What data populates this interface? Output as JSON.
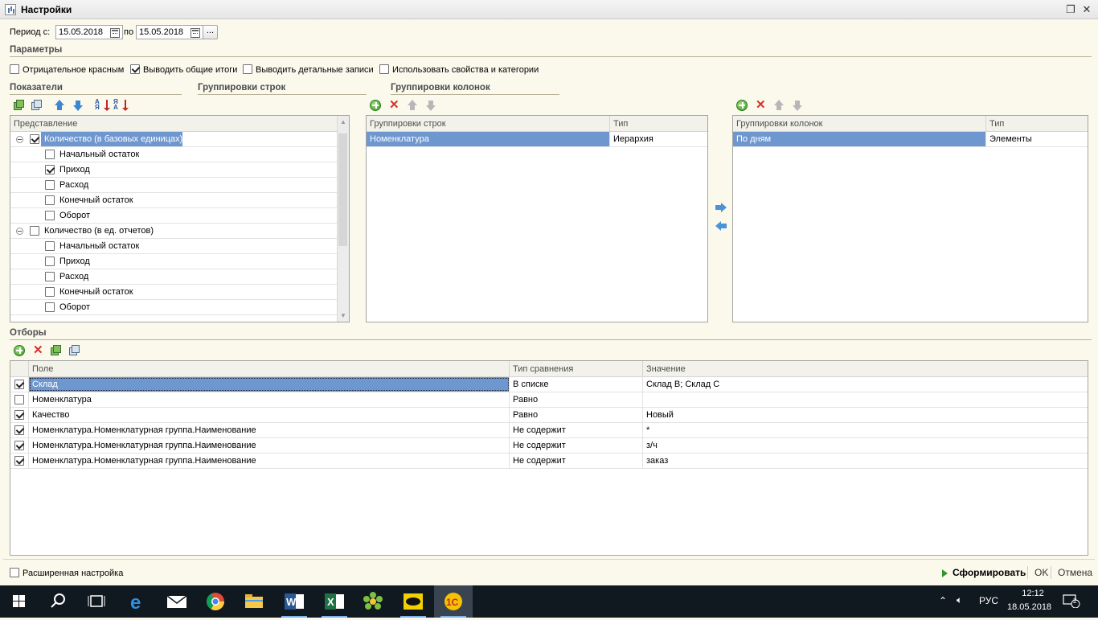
{
  "window": {
    "title": "Настройки"
  },
  "period": {
    "from_label": "Период с:",
    "from_value": "15.05.2018",
    "to_label": "по",
    "to_value": "15.05.2018",
    "more_label": "..."
  },
  "parameters": {
    "title": "Параметры",
    "options": [
      {
        "label": "Отрицательное красным",
        "checked": false
      },
      {
        "label": "Выводить общие итоги",
        "checked": true
      },
      {
        "label": "Выводить детальные записи",
        "checked": false
      },
      {
        "label": "Использовать свойства и категории",
        "checked": false
      }
    ]
  },
  "indicators": {
    "title": "Показатели",
    "header": "Представление",
    "groups": [
      {
        "label": "Количество (в базовых единицах)",
        "checked": true,
        "selected": true,
        "items": [
          {
            "label": "Начальный остаток",
            "checked": false
          },
          {
            "label": "Приход",
            "checked": true
          },
          {
            "label": "Расход",
            "checked": false
          },
          {
            "label": "Конечный остаток",
            "checked": false
          },
          {
            "label": "Оборот",
            "checked": false
          }
        ]
      },
      {
        "label": "Количество (в ед. отчетов)",
        "checked": false,
        "selected": false,
        "items": [
          {
            "label": "Начальный остаток",
            "checked": false
          },
          {
            "label": "Приход",
            "checked": false
          },
          {
            "label": "Расход",
            "checked": false
          },
          {
            "label": "Конечный остаток",
            "checked": false
          },
          {
            "label": "Оборот",
            "checked": false
          }
        ]
      }
    ]
  },
  "row_groupings": {
    "title": "Группировки строк",
    "columns": [
      "Группировки строк",
      "Тип"
    ],
    "rows": [
      [
        "Номенклатура",
        "Иерархия"
      ]
    ]
  },
  "column_groupings": {
    "title": "Группировки колонок",
    "columns": [
      "Группировки колонок",
      "Тип"
    ],
    "rows": [
      [
        "По дням",
        "Элементы"
      ]
    ]
  },
  "filters": {
    "title": "Отборы",
    "columns": [
      "Поле",
      "Тип сравнения",
      "Значение"
    ],
    "rows": [
      {
        "checked": true,
        "field": "Склад",
        "comparison": "В списке",
        "value": "Склад В; Склад С",
        "selected": true
      },
      {
        "checked": false,
        "field": "Номенклатура",
        "comparison": "Равно",
        "value": "",
        "selected": false
      },
      {
        "checked": true,
        "field": "Качество",
        "comparison": "Равно",
        "value": "Новый",
        "selected": false
      },
      {
        "checked": true,
        "field": "Номенклатура.Номенклатурная группа.Наименование",
        "comparison": "Не содержит",
        "value": "*",
        "selected": false
      },
      {
        "checked": true,
        "field": "Номенклатура.Номенклатурная группа.Наименование",
        "comparison": "Не содержит",
        "value": "з/ч",
        "selected": false
      },
      {
        "checked": true,
        "field": "Номенклатура.Номенклатурная группа.Наименование",
        "comparison": "Не содержит",
        "value": "заказ",
        "selected": false
      }
    ]
  },
  "footer": {
    "advanced_label": "Расширенная настройка",
    "generate_label": "Сформировать",
    "ok_label": "OK",
    "cancel_label": "Отмена"
  },
  "taskbar": {
    "apps": [
      "start-icon",
      "search-icon",
      "task-view-icon",
      "edge-icon",
      "mail-icon",
      "chrome-icon",
      "explorer-icon",
      "word-icon",
      "excel-icon",
      "icq-icon",
      "batman-icon",
      "1c-icon"
    ],
    "language": "РУС",
    "time": "12:12",
    "date": "18.05.2018",
    "notifications": "2"
  },
  "colors": {
    "accent": "#6f97cf",
    "section_title": "#4c4c4c",
    "background": "#fbf9ec",
    "taskbar": "#101820"
  }
}
